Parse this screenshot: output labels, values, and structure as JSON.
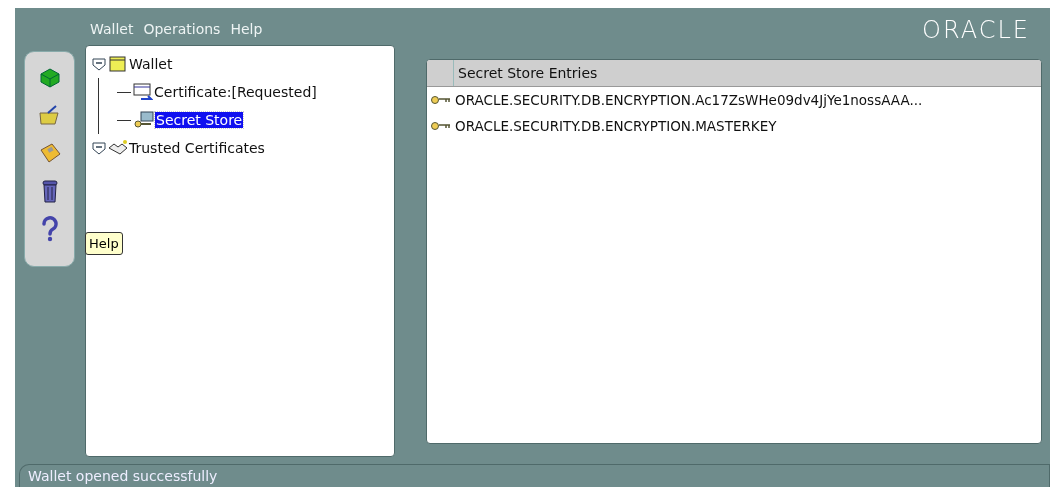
{
  "menu": [
    {
      "label": "Wallet"
    },
    {
      "label": "Operations"
    },
    {
      "label": "Help"
    }
  ],
  "logo": "ORACLE",
  "toolbar": {
    "buttons": [
      {
        "kind": "new"
      },
      {
        "kind": "open"
      },
      {
        "kind": "save"
      },
      {
        "kind": "delete"
      },
      {
        "kind": "help"
      }
    ],
    "tooltip": "Help"
  },
  "tree": [
    {
      "label": "Wallet",
      "kind": "wallet",
      "expanded": true,
      "selected": false,
      "children": [
        {
          "label": "Certificate:[Requested]",
          "kind": "certificate",
          "selected": false
        },
        {
          "label": "Secret Store",
          "kind": "secret",
          "selected": true
        }
      ]
    },
    {
      "label": "Trusted Certificates",
      "kind": "trusted",
      "expanded": true,
      "selected": false
    }
  ],
  "table": {
    "columns": [
      "Secret Store Entries"
    ],
    "rows": [
      {
        "name": "ORACLE.SECURITY.DB.ENCRYPTION.Ac17ZsWHe09dv4JjYe1nossAAA..."
      },
      {
        "name": "ORACLE.SECURITY.DB.ENCRYPTION.MASTERKEY"
      }
    ]
  },
  "status_bar": "Wallet opened successfully"
}
